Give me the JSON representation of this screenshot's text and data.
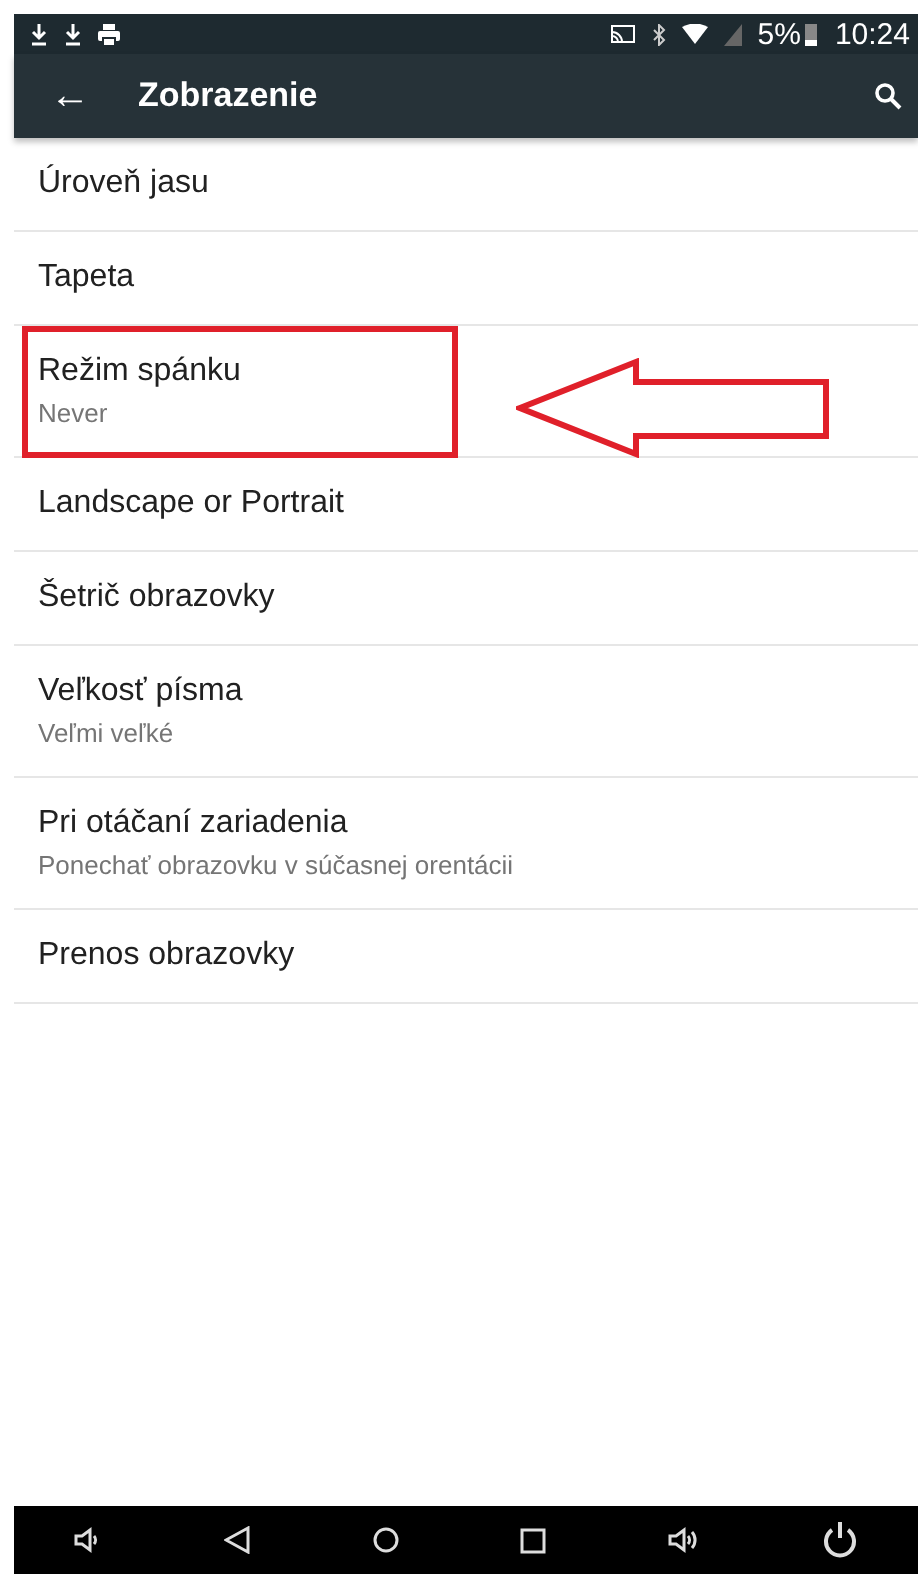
{
  "status_bar": {
    "battery": "5%",
    "time": "10:24"
  },
  "app_bar": {
    "back": "←",
    "title": "Zobrazenie"
  },
  "items": [
    {
      "title": "Úroveň jasu",
      "highlighted": false
    },
    {
      "title": "Tapeta",
      "highlighted": false
    },
    {
      "title": "Režim spánku",
      "summary": "Never",
      "highlighted": true
    },
    {
      "title": "Landscape or Portrait",
      "highlighted": false
    },
    {
      "title": "Šetrič obrazovky",
      "highlighted": false
    },
    {
      "title": "Veľkosť písma",
      "summary": "Veľmi veľké",
      "highlighted": false
    },
    {
      "title": "Pri otáčaní zariadenia",
      "summary": "Ponechať obrazovku v súčasnej orentácii",
      "highlighted": false
    },
    {
      "title": "Prenos obrazovky",
      "highlighted": false
    }
  ]
}
